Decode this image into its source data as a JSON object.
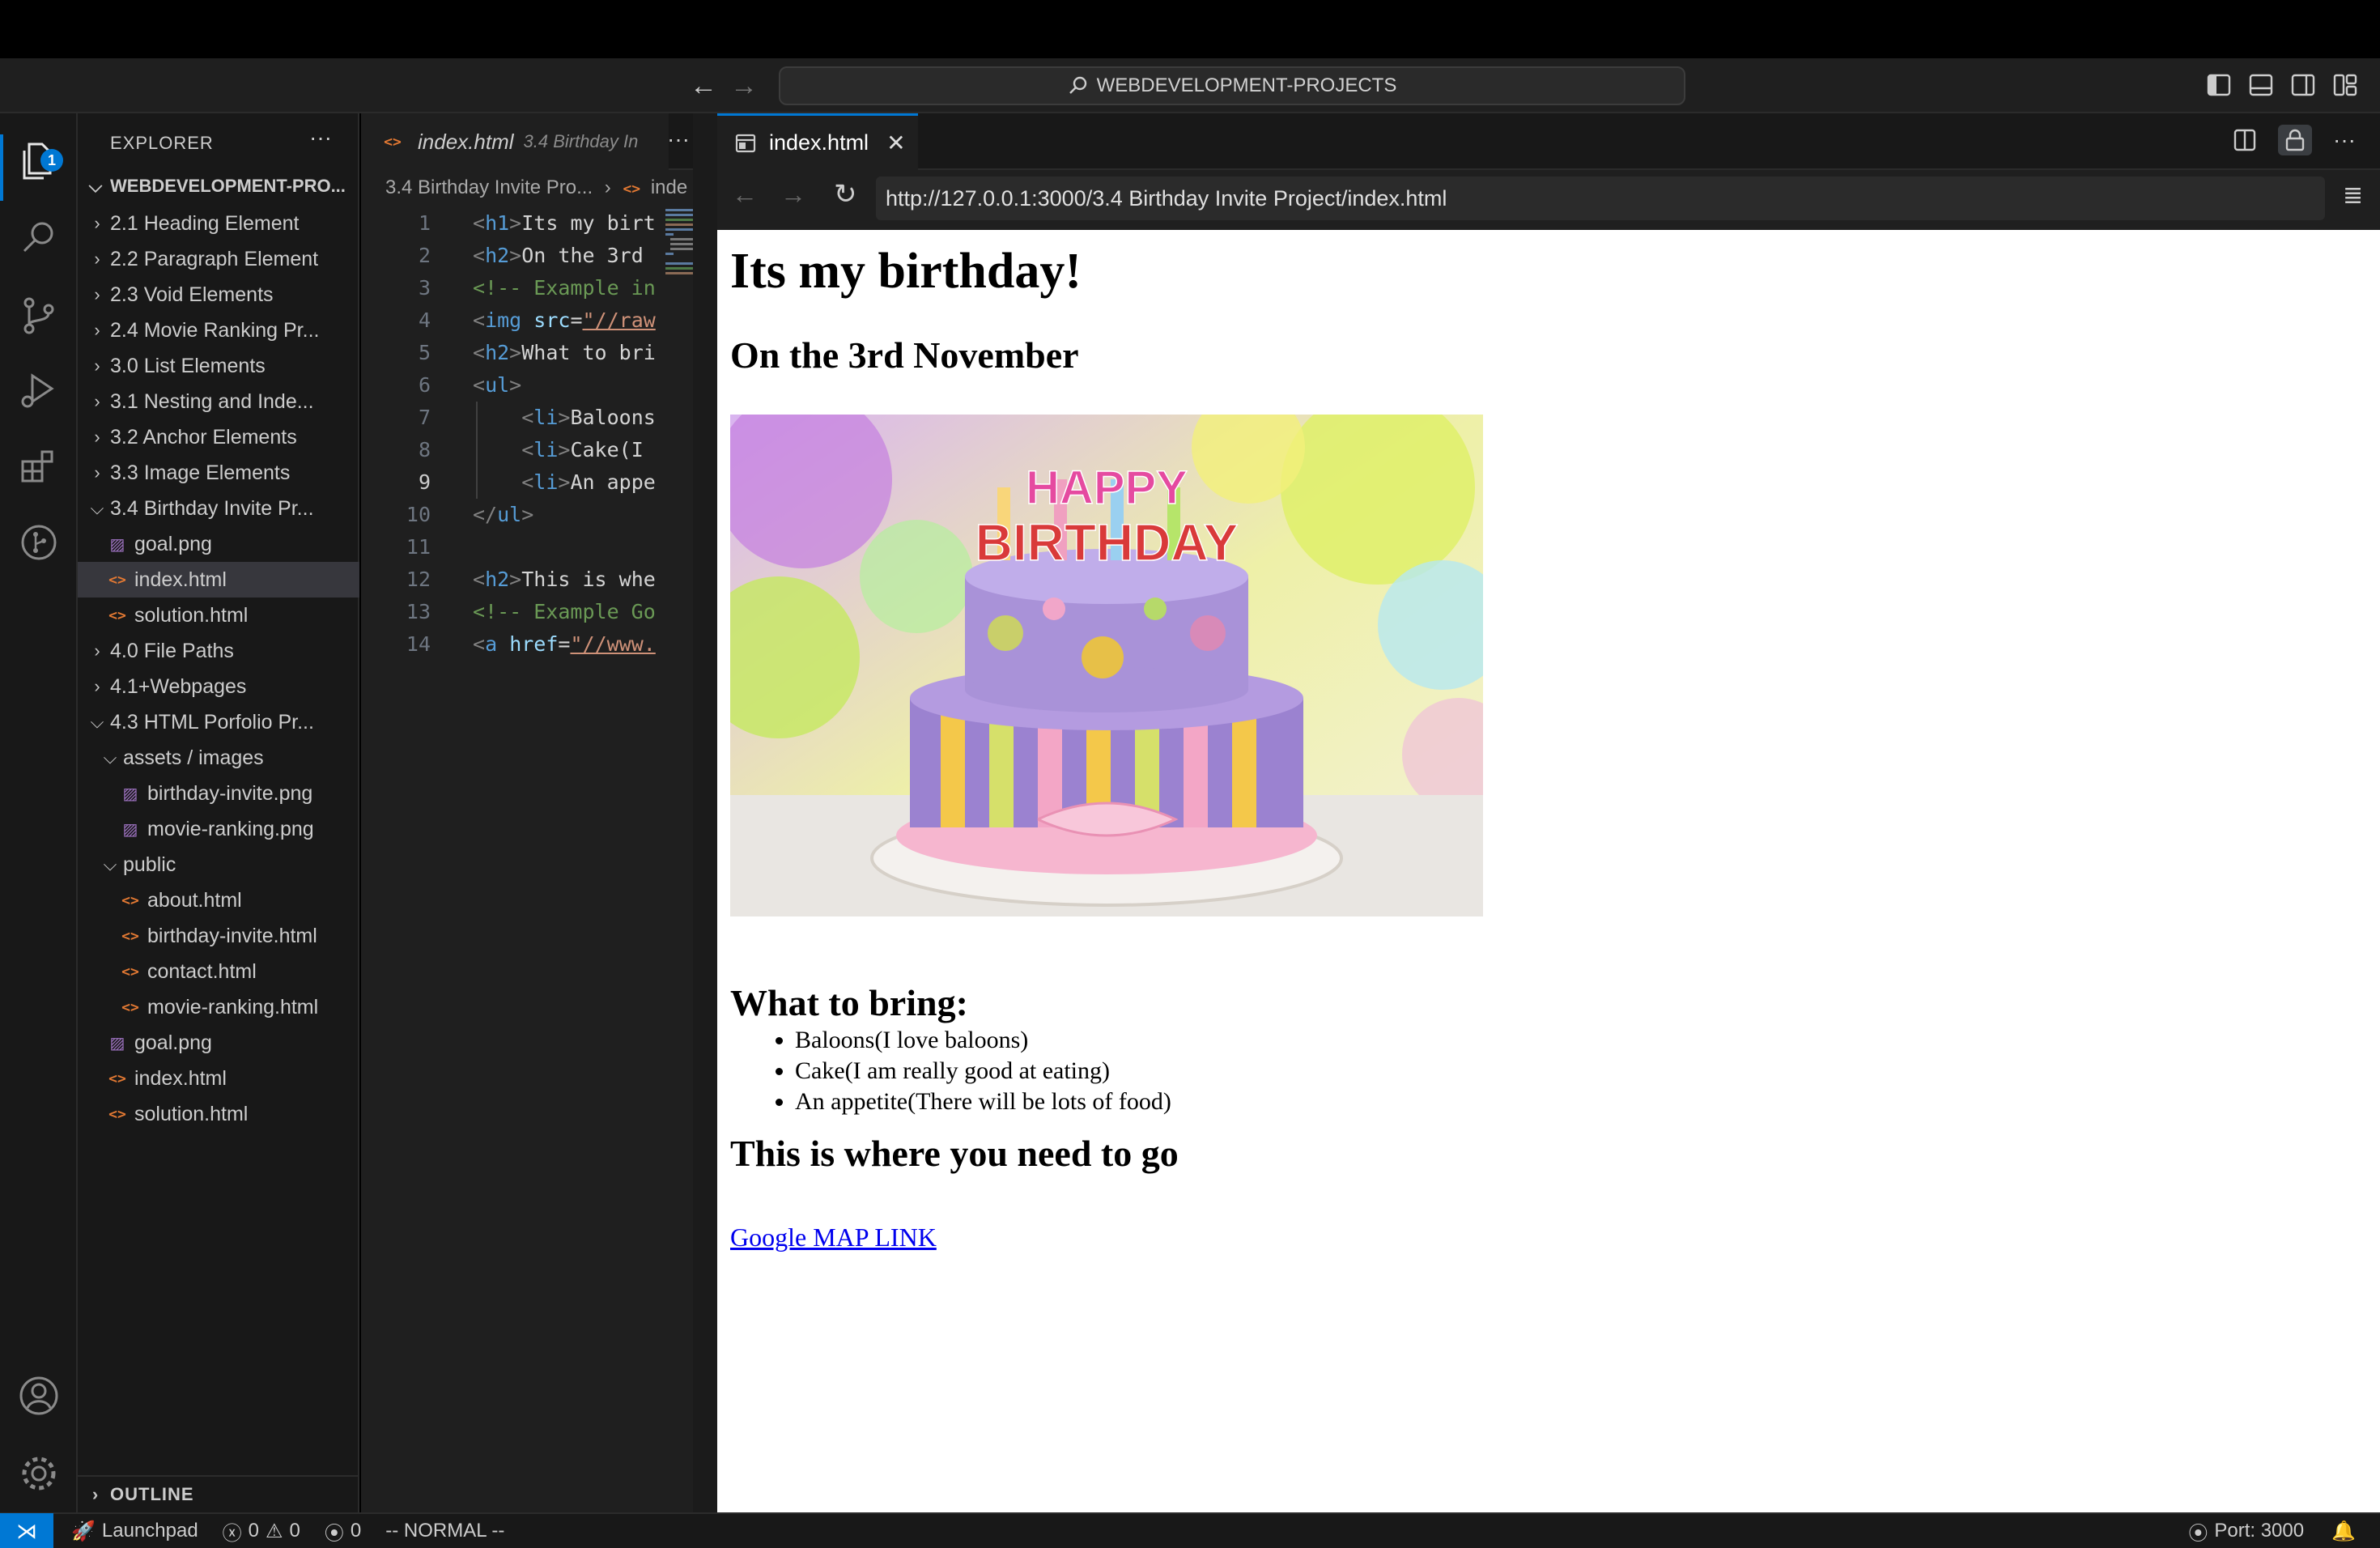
{
  "titlebar": {
    "search": "WEBDEVELOPMENT-PROJECTS"
  },
  "activity": {
    "explorer_badge": "1"
  },
  "sidebar": {
    "header": "EXPLORER",
    "more": "···",
    "root": "WEBDEVELOPMENT-PRO...",
    "items": [
      {
        "label": "2.1 Heading Element",
        "kind": "folder",
        "open": false,
        "depth": 0
      },
      {
        "label": "2.2 Paragraph Element",
        "kind": "folder",
        "open": false,
        "depth": 0
      },
      {
        "label": "2.3 Void Elements",
        "kind": "folder",
        "open": false,
        "depth": 0
      },
      {
        "label": "2.4 Movie Ranking Pr...",
        "kind": "folder",
        "open": false,
        "depth": 0
      },
      {
        "label": "3.0 List Elements",
        "kind": "folder",
        "open": false,
        "depth": 0
      },
      {
        "label": "3.1 Nesting and Inde...",
        "kind": "folder",
        "open": false,
        "depth": 0
      },
      {
        "label": "3.2 Anchor Elements",
        "kind": "folder",
        "open": false,
        "depth": 0
      },
      {
        "label": "3.3 Image Elements",
        "kind": "folder",
        "open": false,
        "depth": 0
      },
      {
        "label": "3.4 Birthday Invite Pr...",
        "kind": "folder",
        "open": true,
        "depth": 0
      },
      {
        "label": "goal.png",
        "kind": "img",
        "depth": 1
      },
      {
        "label": "index.html",
        "kind": "html",
        "depth": 1,
        "selected": true
      },
      {
        "label": "solution.html",
        "kind": "html",
        "depth": 1
      },
      {
        "label": "4.0 File Paths",
        "kind": "folder",
        "open": false,
        "depth": 0
      },
      {
        "label": "4.1+Webpages",
        "kind": "folder",
        "open": false,
        "depth": 0
      },
      {
        "label": "4.3 HTML Porfolio Pr...",
        "kind": "folder",
        "open": true,
        "depth": 0
      },
      {
        "label": "assets / images",
        "kind": "folder",
        "open": true,
        "depth": 1
      },
      {
        "label": "birthday-invite.png",
        "kind": "img",
        "depth": 2
      },
      {
        "label": "movie-ranking.png",
        "kind": "img",
        "depth": 2
      },
      {
        "label": "public",
        "kind": "folder",
        "open": true,
        "depth": 1
      },
      {
        "label": "about.html",
        "kind": "html",
        "depth": 2
      },
      {
        "label": "birthday-invite.html",
        "kind": "html",
        "depth": 2
      },
      {
        "label": "contact.html",
        "kind": "html",
        "depth": 2
      },
      {
        "label": "movie-ranking.html",
        "kind": "html",
        "depth": 2
      },
      {
        "label": "goal.png",
        "kind": "img",
        "depth": 1
      },
      {
        "label": "index.html",
        "kind": "html",
        "depth": 1
      },
      {
        "label": "solution.html",
        "kind": "html",
        "depth": 1
      }
    ],
    "outline": "OUTLINE"
  },
  "editor": {
    "tab_name": "index.html",
    "tab_desc": "3.4 Birthday In",
    "breadcrumb_folder": "3.4 Birthday Invite Pro...",
    "breadcrumb_file": "inde",
    "current_line": 9,
    "lines": [
      {
        "n": "1",
        "html": "<span class=\"br\">&lt;</span><span class=\"tag\">h1</span><span class=\"br\">&gt;</span><span class=\"txt\">Its my birt</span>"
      },
      {
        "n": "2",
        "html": "<span class=\"br\">&lt;</span><span class=\"tag\">h2</span><span class=\"br\">&gt;</span><span class=\"txt\">On the 3rd</span>"
      },
      {
        "n": "3",
        "html": "<span class=\"cmt\">&lt;!-- Example in</span>"
      },
      {
        "n": "4",
        "html": "<span class=\"br\">&lt;</span><span class=\"tag\">img</span> <span class=\"attr\">src</span><span class=\"txt\">=</span><span class=\"str\">\"//raw</span>"
      },
      {
        "n": "5",
        "html": "<span class=\"br\">&lt;</span><span class=\"tag\">h2</span><span class=\"br\">&gt;</span><span class=\"txt\">What to bri</span>"
      },
      {
        "n": "6",
        "html": "<span class=\"br\">&lt;</span><span class=\"tag\">ul</span><span class=\"br\">&gt;</span>"
      },
      {
        "n": "7",
        "html": "    <span class=\"br\">&lt;</span><span class=\"tag\">li</span><span class=\"br\">&gt;</span><span class=\"txt\">Baloons</span>"
      },
      {
        "n": "8",
        "html": "    <span class=\"br\">&lt;</span><span class=\"tag\">li</span><span class=\"br\">&gt;</span><span class=\"txt\">Cake(I</span>"
      },
      {
        "n": "9",
        "html": "    <span class=\"br\">&lt;</span><span class=\"tag\">li</span><span class=\"br\">&gt;</span><span class=\"txt\">An appe</span>"
      },
      {
        "n": "10",
        "html": "<span class=\"br\">&lt;/</span><span class=\"tag\">ul</span><span class=\"br\">&gt;</span>"
      },
      {
        "n": "11",
        "html": ""
      },
      {
        "n": "12",
        "html": "<span class=\"br\">&lt;</span><span class=\"tag\">h2</span><span class=\"br\">&gt;</span><span class=\"txt\">This is whe</span>"
      },
      {
        "n": "13",
        "html": "<span class=\"cmt\">&lt;!-- Example Go</span>"
      },
      {
        "n": "14",
        "html": "<span class=\"br\">&lt;</span><span class=\"tag\">a</span> <span class=\"attr\">href</span><span class=\"txt\">=</span><span class=\"str\">\"//www.</span>"
      }
    ]
  },
  "preview": {
    "tab_name": "index.html",
    "url": "http://127.0.0.1:3000/3.4 Birthday Invite Project/index.html",
    "page": {
      "h1": "Its my birthday!",
      "date": "On the 3rd November",
      "bring_heading": "What to bring:",
      "items": [
        "Baloons(I love baloons)",
        "Cake(I am really good at eating)",
        "An appetite(There will be lots of food)"
      ],
      "where_heading": "This is where you need to go",
      "link": "Google MAP LINK",
      "cake_text_top": "HAPPY",
      "cake_text_bottom": "BIRTHDAY"
    }
  },
  "statusbar": {
    "launchpad": "Launchpad",
    "errors": "0",
    "warnings": "0",
    "ports_count": "0",
    "mode": "-- NORMAL --",
    "port": "Port: 3000"
  },
  "colors": {
    "accent": "#0078d4",
    "editor_bg": "#1f1f1f",
    "sidebar_bg": "#181818",
    "link": "#0000ee"
  }
}
